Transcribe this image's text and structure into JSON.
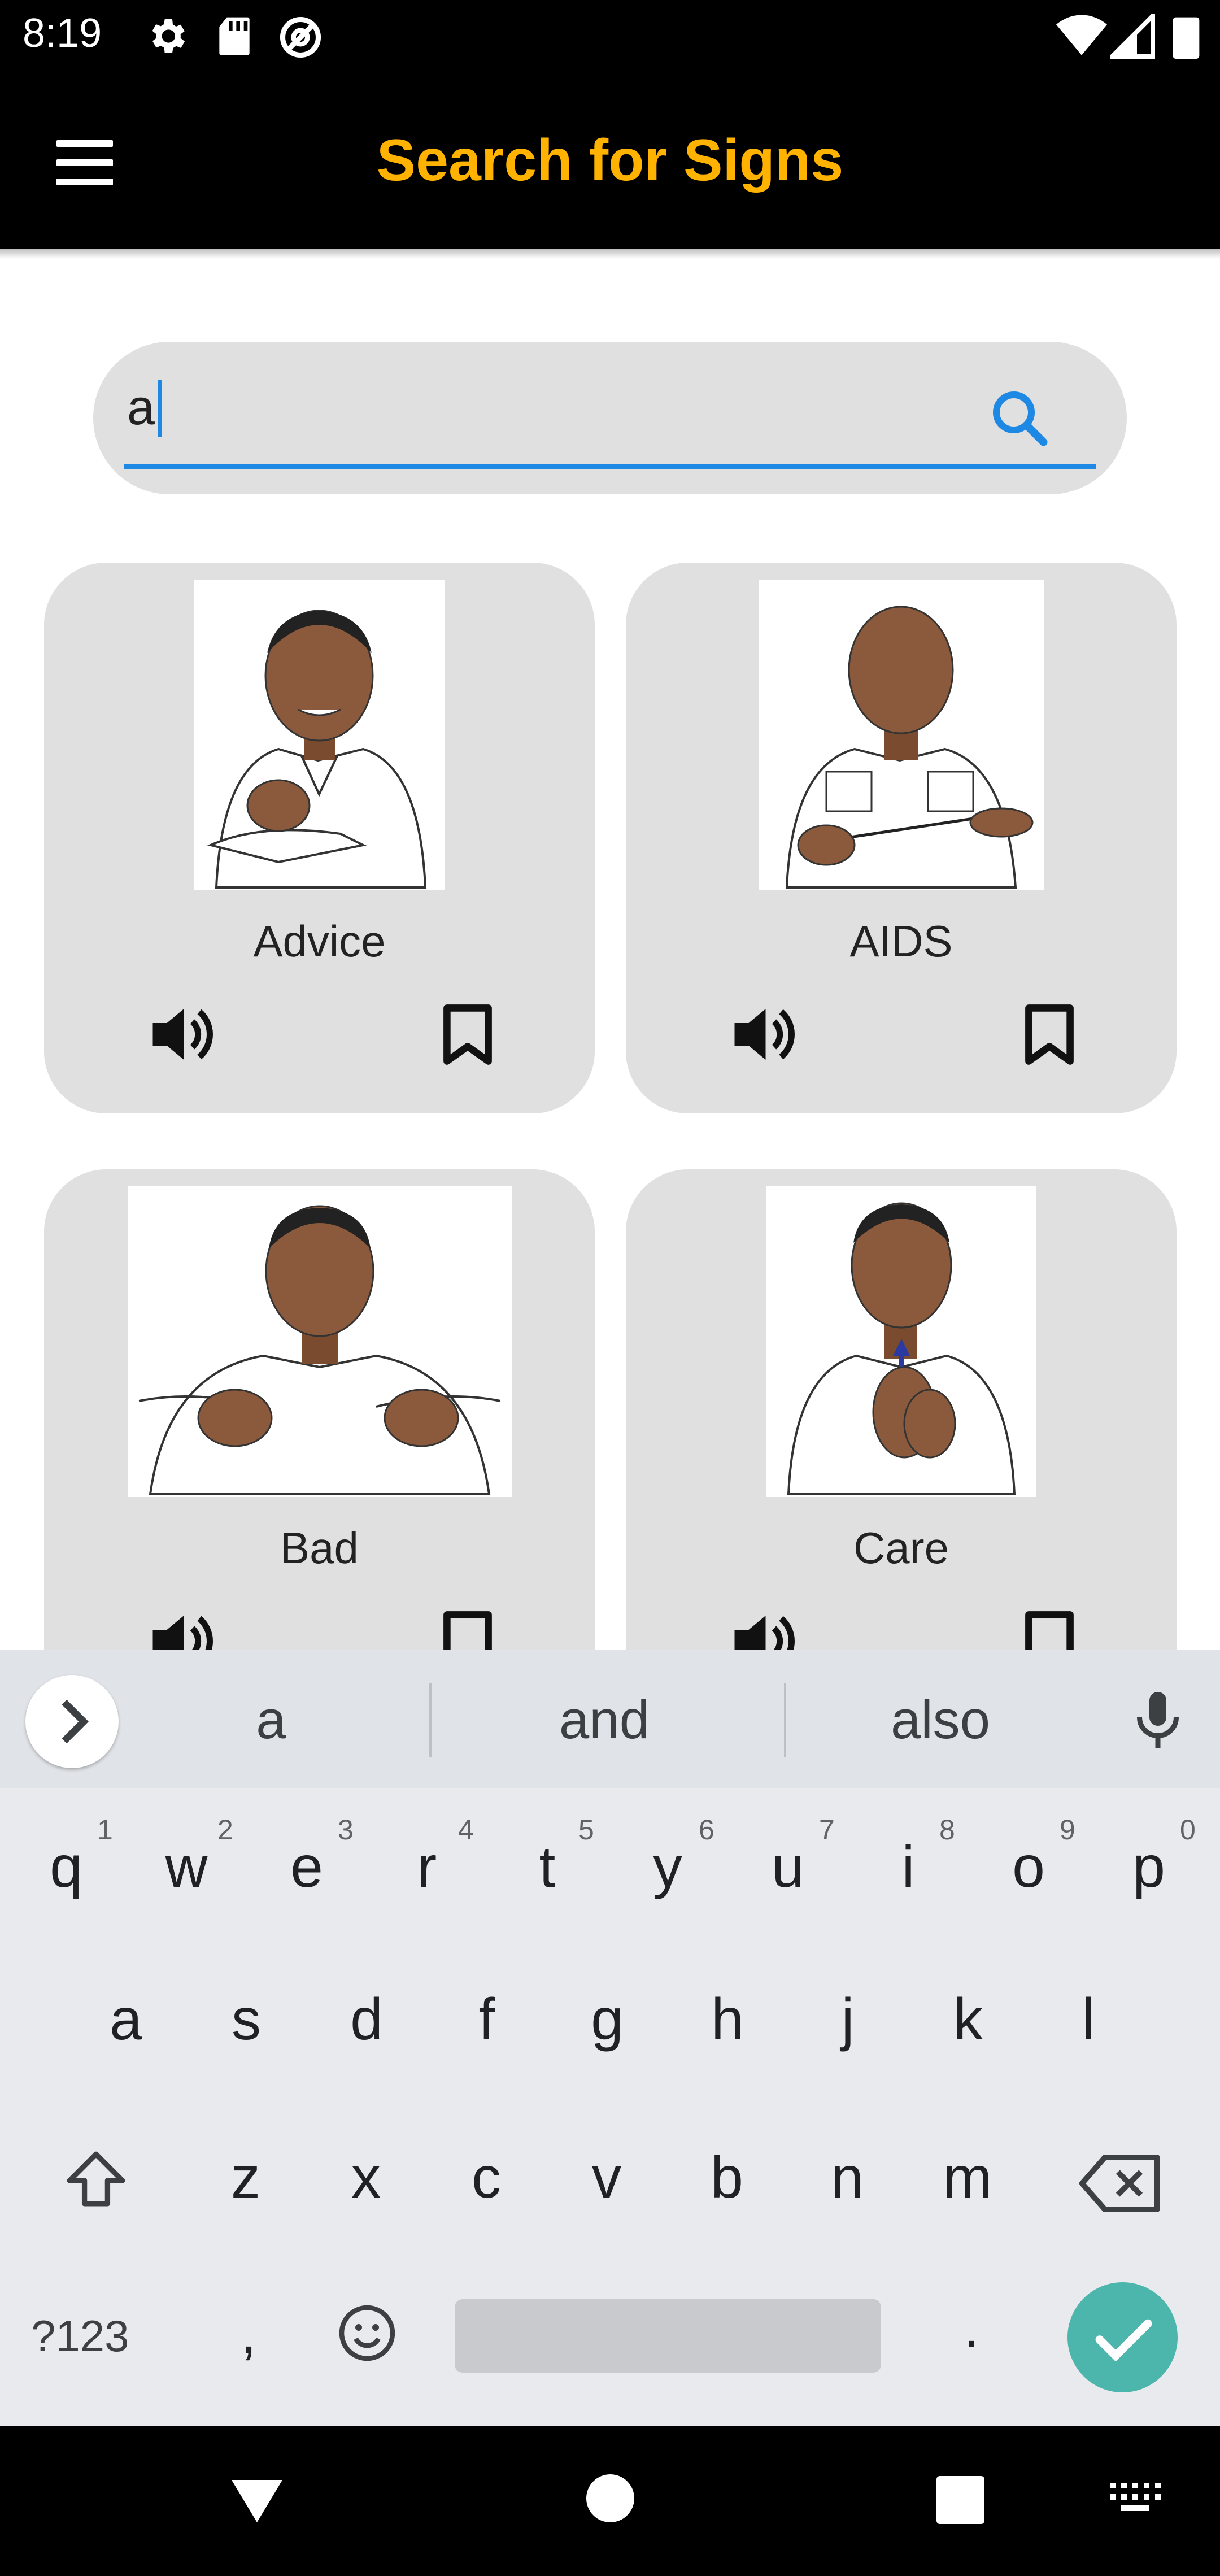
{
  "status_bar": {
    "time": "8:19"
  },
  "app_bar": {
    "title": "Search for Signs"
  },
  "search": {
    "value": "a"
  },
  "cards": [
    {
      "label": "Advice"
    },
    {
      "label": "AIDS"
    },
    {
      "label": "Bad"
    },
    {
      "label": "Care"
    }
  ],
  "keyboard": {
    "suggestions": [
      "a",
      "and",
      "also"
    ],
    "row1": [
      "q",
      "w",
      "e",
      "r",
      "t",
      "y",
      "u",
      "i",
      "o",
      "p"
    ],
    "row1_hints": [
      "1",
      "2",
      "3",
      "4",
      "5",
      "6",
      "7",
      "8",
      "9",
      "0"
    ],
    "row2": [
      "a",
      "s",
      "d",
      "f",
      "g",
      "h",
      "j",
      "k",
      "l"
    ],
    "row3": [
      "z",
      "x",
      "c",
      "v",
      "b",
      "n",
      "m"
    ],
    "symbols_label": "?123",
    "comma": ",",
    "period": "."
  },
  "colors": {
    "accent": "#ffb300",
    "focus": "#1e88e5",
    "enter": "#4db6ac"
  }
}
